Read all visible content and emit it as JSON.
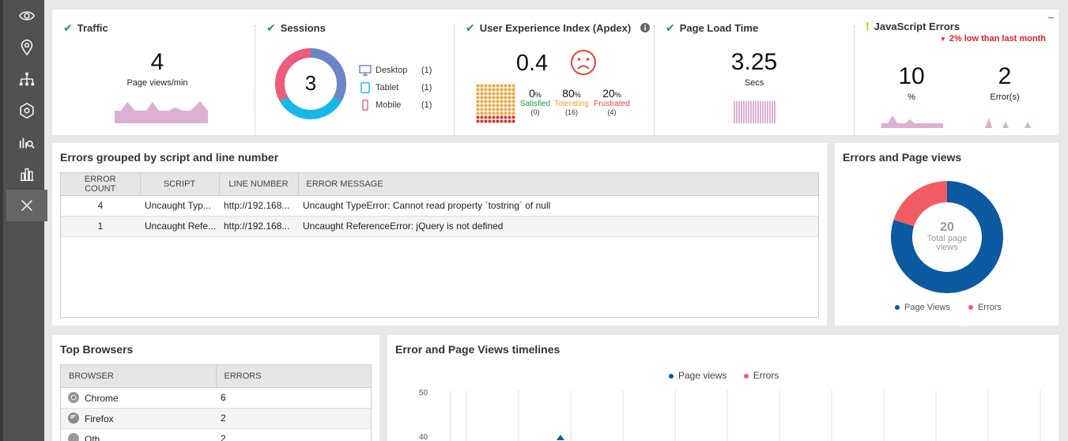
{
  "sidebar": {
    "items": [
      {
        "icon": "eye-icon"
      },
      {
        "icon": "location-pin-icon"
      },
      {
        "icon": "network-icon"
      },
      {
        "icon": "hub-icon"
      },
      {
        "icon": "analytics-search-icon"
      },
      {
        "icon": "bar-chart-icon"
      },
      {
        "icon": "close-icon"
      }
    ]
  },
  "metrics": {
    "traffic": {
      "title": "Traffic",
      "value": "4",
      "unit": "Page views/min"
    },
    "sessions": {
      "title": "Sessions",
      "value": "3",
      "devices": [
        {
          "label": "Desktop",
          "count": "(1)",
          "icon": "desktop-icon"
        },
        {
          "label": "Tablet",
          "count": "(1)",
          "icon": "tablet-icon"
        },
        {
          "label": "Mobile",
          "count": "(1)",
          "icon": "mobile-icon"
        }
      ]
    },
    "apdex": {
      "title": "User Experience Index (Apdex)",
      "value": "0.4",
      "satisfied": {
        "pct": "0",
        "label": "Satisfied",
        "count": "(0)"
      },
      "tolerating": {
        "pct": "80",
        "label": "Tolerating",
        "count": "(16)"
      },
      "frustrated": {
        "pct": "20",
        "label": "Frustrated",
        "count": "(4)"
      },
      "pct_sign": "%"
    },
    "load": {
      "title": "Page Load Time",
      "value": "3.25",
      "unit": "Secs"
    },
    "js": {
      "title": "JavaScript Errors",
      "trend": "2% low than last month",
      "rate": "10",
      "rate_unit": "%",
      "errors": "2",
      "errors_unit": "Error(s)",
      "minimize": "–"
    }
  },
  "errors_panel": {
    "title": "Errors grouped by script and line number",
    "columns": [
      "ERROR COUNT",
      "SCRIPT",
      "LINE NUMBER",
      "ERROR MESSAGE"
    ],
    "rows": [
      [
        "4",
        "Uncaught Typ...",
        "http://192.168...",
        "Uncaught TypeError: Cannot read property ´tostring´ of null"
      ],
      [
        "1",
        "Uncaught Refe...",
        "http://192.168...",
        "Uncaught ReferenceError: jQuery is not defined"
      ]
    ]
  },
  "donut_panel": {
    "title": "Errors and Page views",
    "center_value": "20",
    "center_label_1": "Total page",
    "center_label_2": "views",
    "legend": [
      {
        "label": "Page Views",
        "color": "#0b5aa2"
      },
      {
        "label": "Errors",
        "color": "#f25d63"
      }
    ]
  },
  "browsers_panel": {
    "title": "Top Browsers",
    "columns": [
      "BROWSER",
      "ERRORS"
    ],
    "rows": [
      {
        "name": "Chrome",
        "errors": "6",
        "icon": "chrome-icon"
      },
      {
        "name": "Firefox",
        "errors": "2",
        "icon": "firefox-icon"
      },
      {
        "name": "Oth",
        "errors": "2",
        "icon": "browser-icon"
      }
    ]
  },
  "timeline_panel": {
    "title": "Error and Page Views timelines",
    "legend": [
      {
        "label": "Page views",
        "color": "#0b5aa2"
      },
      {
        "label": "Errors",
        "color": "#f25d63"
      }
    ],
    "y_ticks": [
      "50",
      "40"
    ]
  },
  "chart_data": [
    {
      "type": "pie",
      "title": "Errors and Page views",
      "categories": [
        "Page Views",
        "Errors"
      ],
      "values": [
        16,
        4
      ],
      "center_total": 20
    },
    {
      "type": "pie",
      "title": "Sessions",
      "categories": [
        "Desktop",
        "Tablet",
        "Mobile"
      ],
      "values": [
        1,
        1,
        1
      ]
    }
  ]
}
